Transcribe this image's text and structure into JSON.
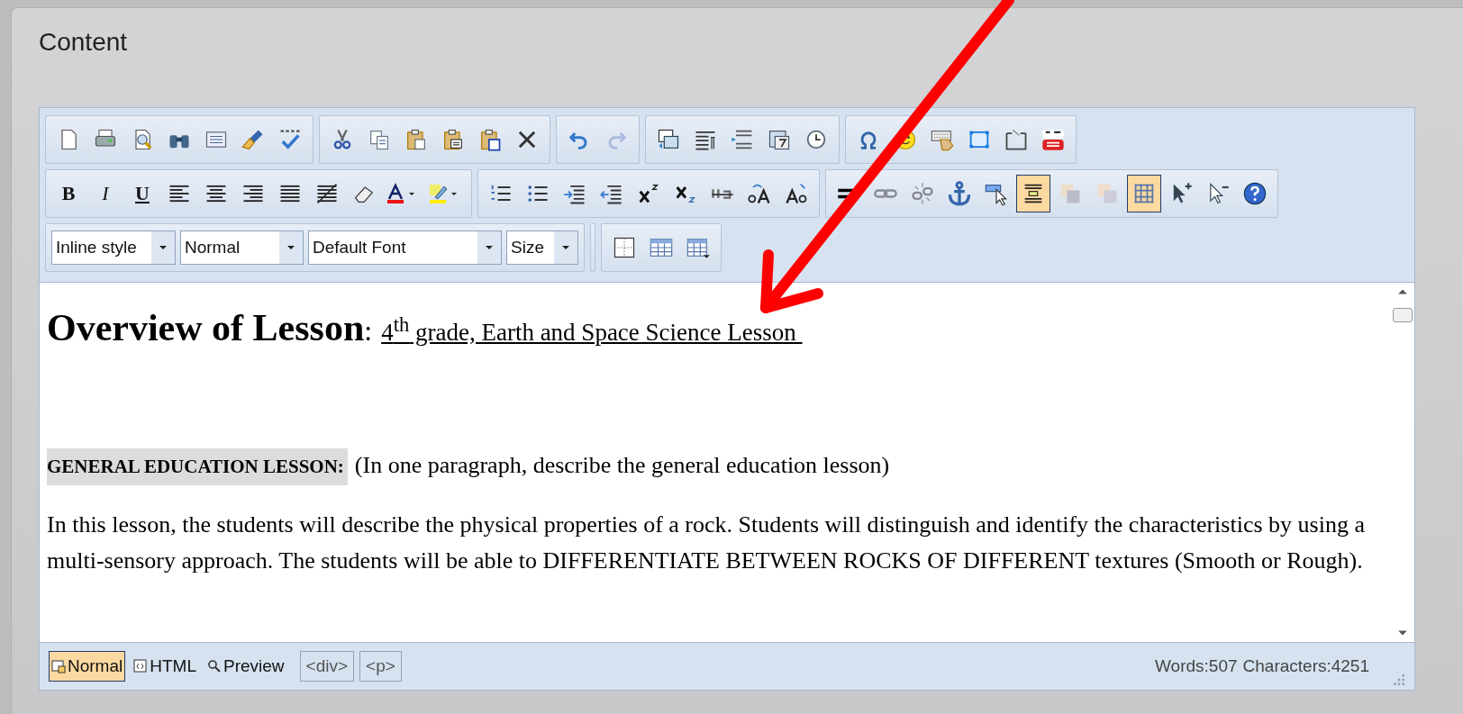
{
  "panel": {
    "title": "Content"
  },
  "toolbar": {
    "format_labels": [
      "B",
      "I",
      "U"
    ],
    "toggles": [
      {
        "selected": true
      },
      {
        "selected": true
      }
    ],
    "dropdowns": [
      {
        "value": "Inline style"
      },
      {
        "value": "Normal"
      },
      {
        "value": "Default Font"
      },
      {
        "value": "Size"
      }
    ]
  },
  "document": {
    "heading": {
      "title": "Overview of Lesson",
      "separator": ":",
      "subtitle": "4$^{th}$ grade, Earth and Space Science Lesson "
    },
    "section_label": "GENERAL EDUCATION LESSON:",
    "section_hint": "(In one paragraph, describe the general education lesson)",
    "paragraph": "In this lesson, the students will describe the physical properties of a rock. Students will distinguish and identify the characteristics by using a multi-sensory approach. The students will be able to DIFFERENTIATE BETWEEN ROCKS OF DIFFERENT textures (Smooth or Rough)."
  },
  "modes": [
    {
      "label": "Normal",
      "selected": true
    },
    {
      "label": "HTML",
      "selected": false
    },
    {
      "label": "Preview",
      "selected": false
    }
  ],
  "tags": [
    "<div>",
    "<p>"
  ],
  "status": {
    "words": "Words:507",
    "characters": "Characters:4251"
  }
}
